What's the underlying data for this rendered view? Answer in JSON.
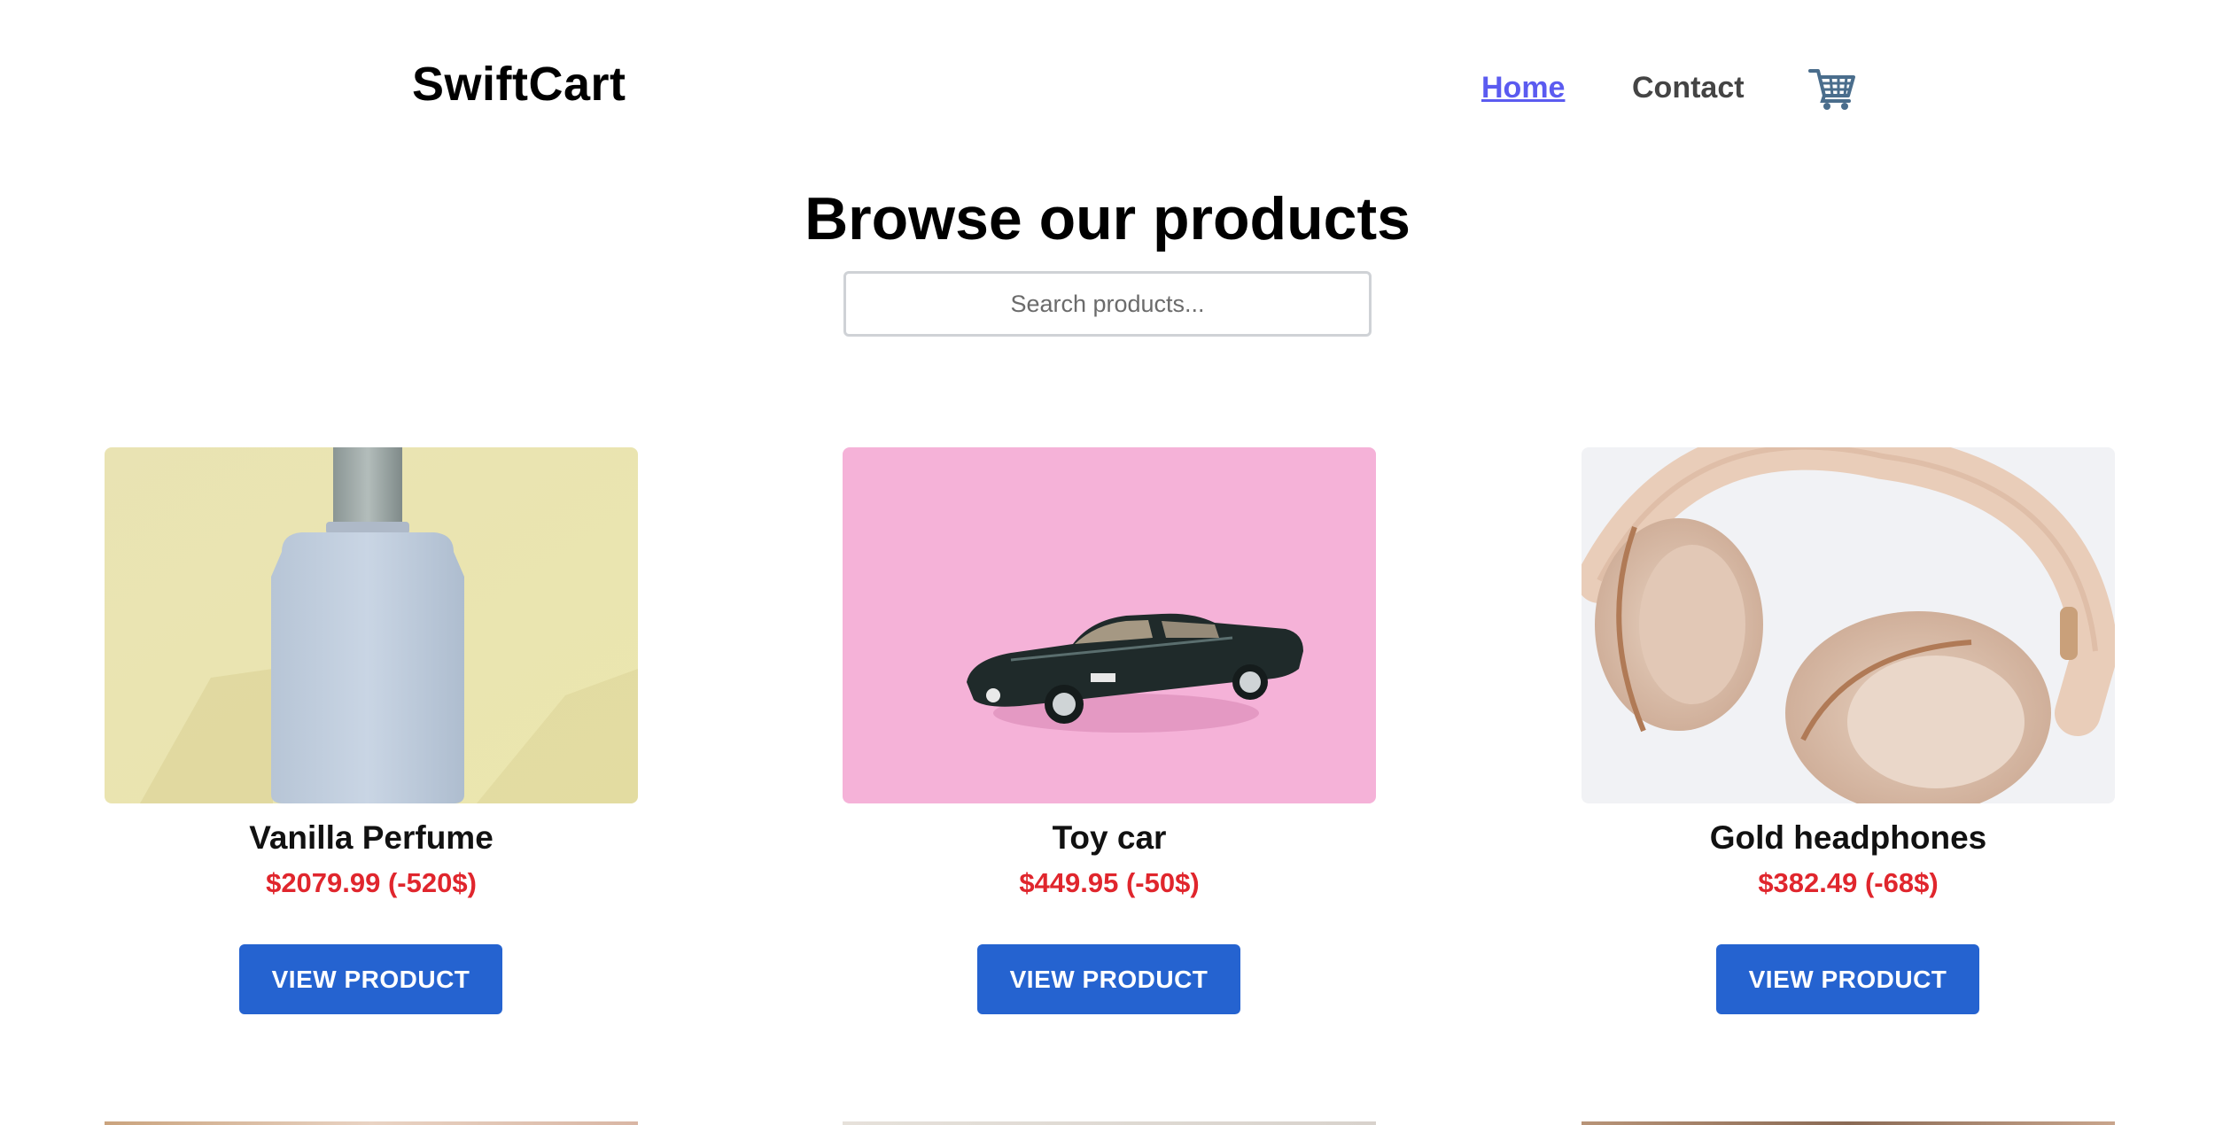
{
  "header": {
    "logo": "SwiftCart",
    "nav": {
      "home_label": "Home",
      "contact_label": "Contact"
    },
    "cart_icon": "shopping-cart-icon"
  },
  "main": {
    "title": "Browse our products",
    "search": {
      "placeholder": "Search products...",
      "value": ""
    },
    "products": [
      {
        "name": "Vanilla Perfume",
        "price": "$2079.99 (-520$)",
        "button_label": "VIEW PRODUCT",
        "image": "perfume-bottle-image"
      },
      {
        "name": "Toy car",
        "price": "$449.95 (-50$)",
        "button_label": "VIEW PRODUCT",
        "image": "toy-car-image"
      },
      {
        "name": "Gold headphones",
        "price": "$382.49 (-68$)",
        "button_label": "VIEW PRODUCT",
        "image": "headphones-image"
      }
    ]
  },
  "colors": {
    "accent_blue": "#2563d0",
    "link_blue": "#5b5bf0",
    "price_red": "#e0262d"
  }
}
